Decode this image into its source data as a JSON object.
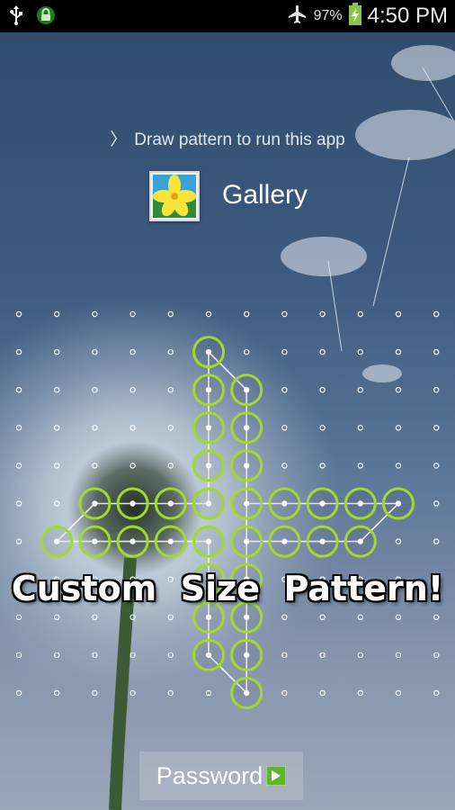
{
  "status_bar": {
    "left_icons": [
      "usb-icon",
      "lock-icon"
    ],
    "right_icons": [
      "airplane-icon",
      "battery-charging-icon"
    ],
    "battery": "97%",
    "time": "4:50 PM"
  },
  "lock_screen": {
    "prompt_chevron": "〉",
    "prompt": "Draw pattern to run this app",
    "app_name": "Gallery",
    "app_icon": "gallery-icon",
    "banner": "Custom  Size  Pattern!",
    "password_button": "Password",
    "password_icon": "arrow-right-icon"
  },
  "pattern": {
    "grid_columns": 12,
    "grid_rows": 11,
    "accent_color": "#a3d92e",
    "dot_color": "#ffffff"
  }
}
